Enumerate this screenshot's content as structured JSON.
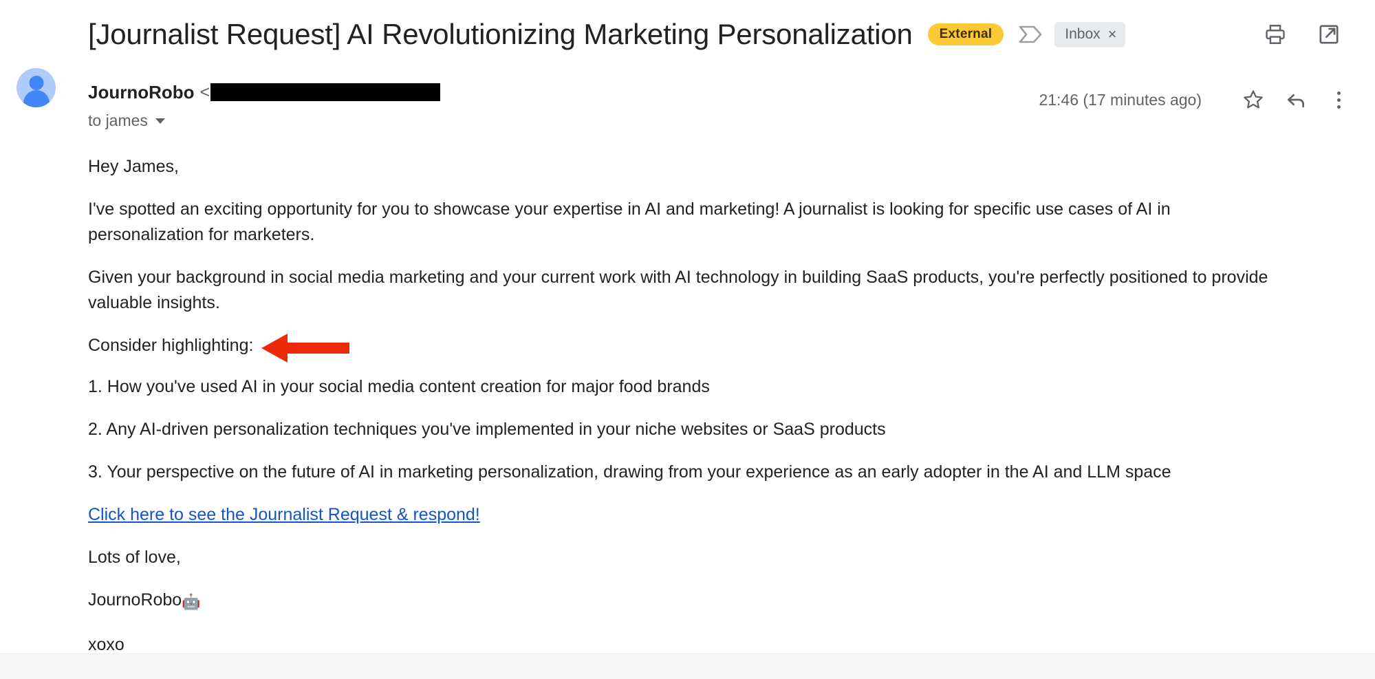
{
  "header": {
    "subject": "[Journalist Request] AI Revolutionizing Marketing Personalization",
    "external_badge": "External",
    "important_marker_icon": "important-chevron-icon",
    "label_chip": "Inbox",
    "label_chip_remove": "×",
    "print_icon": "print-icon",
    "popout_icon": "open-in-new-window-icon",
    "badge_color": "#fcc934",
    "chip_bg_color": "#e8eaed"
  },
  "sender": {
    "name": "JournoRobo",
    "angle_open": "<",
    "email_redacted": true,
    "recipient": "to james",
    "recipient_caret_icon": "chevron-down-icon",
    "avatar_icon": "person-avatar-icon",
    "avatar_bg_color": "#aecbfa",
    "avatar_fg_color": "#4285f4"
  },
  "meta": {
    "timestamp": "21:46 (17 minutes ago)",
    "star_icon": "star-outline-icon",
    "reply_icon": "reply-arrow-icon",
    "more_icon": "more-vertical-icon"
  },
  "body": {
    "greeting": "Hey James,",
    "paragraph_1": "I've spotted an exciting opportunity for you to showcase your expertise in AI and marketing! A journalist is looking for specific use cases of AI in personalization for marketers.",
    "paragraph_2": "Given your background in social media marketing and your current work with AI technology in building SaaS products, you're perfectly positioned to provide valuable insights.",
    "list_intro": "Consider highlighting:",
    "list_item_1": "1. How you've used AI in your social media content creation for major food brands",
    "list_item_2": "2. Any AI-driven personalization techniques you've implemented in your niche websites or SaaS products",
    "list_item_3": "3. Your perspective on the future of AI in marketing personalization, drawing from your experience as an early adopter in the AI and LLM space",
    "cta_link": "Click here to see the Journalist Request & respond!",
    "cta_link_color": "#1155cc",
    "signoff": "Lots of love,",
    "signature_name": "JournoRobo",
    "signature_emoji": "🤖",
    "closing": "xoxo"
  },
  "annotation": {
    "arrow_icon": "left-pointing-arrow-annotation",
    "arrow_color": "#ec2a08",
    "points_at": "Consider highlighting:"
  }
}
